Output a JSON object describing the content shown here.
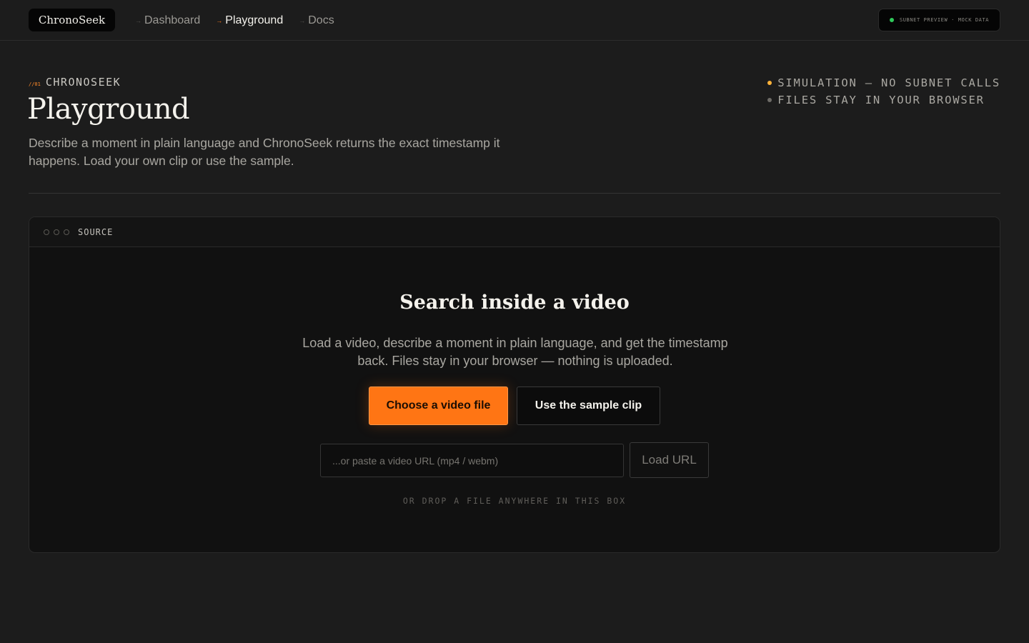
{
  "brand": "ChronoSeek",
  "nav": [
    {
      "label": "Dashboard",
      "active": false
    },
    {
      "label": "Playground",
      "active": true
    },
    {
      "label": "Docs",
      "active": false
    }
  ],
  "nav_arrow": "→",
  "status_pill": "Subnet preview · Mock data",
  "status_color": "#2fc95a",
  "accent_color": "#ff7514",
  "hero": {
    "eyebrow_num": "//01",
    "eyebrow_label": "CHRONOSEEK",
    "title": "Playground",
    "lead": "Describe a moment in plain language and ChronoSeek returns the exact timestamp it happens. Load your own clip or use the sample."
  },
  "notes": [
    "Simulation — no subnet calls",
    "Files stay in your browser"
  ],
  "source": {
    "label": "SOURCE",
    "title": "Search inside a video",
    "text": "Load a video, describe a moment in plain language, and get the timestamp back. Files stay in your browser — nothing is uploaded.",
    "choose_button": "Choose a video file",
    "sample_button": "Use the sample clip",
    "url_placeholder": "...or paste a video URL (mp4 / webm)",
    "url_value": "",
    "load_button": "Load URL",
    "drop_hint": "OR DROP A FILE ANYWHERE IN THIS BOX"
  }
}
